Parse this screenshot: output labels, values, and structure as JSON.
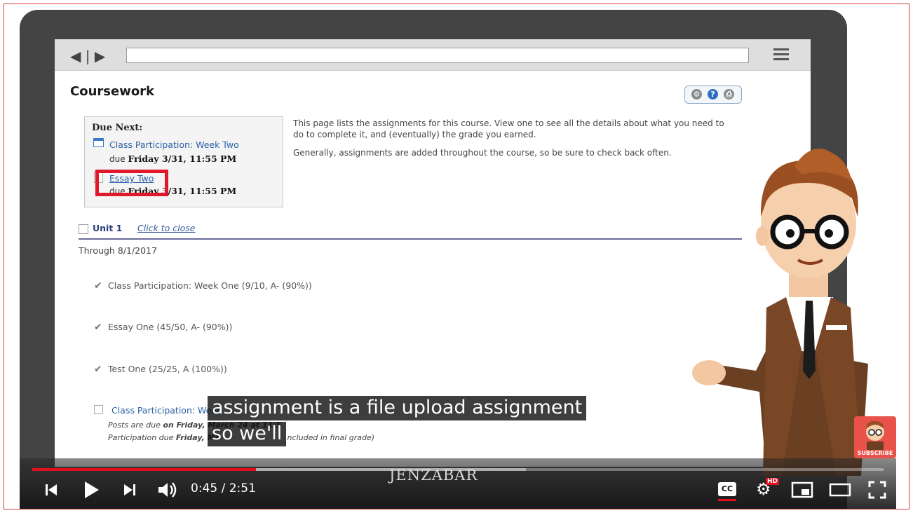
{
  "page": {
    "title": "Coursework",
    "due_next": {
      "heading": "Due Next:",
      "items": [
        {
          "label": "Class Participation: Week Two",
          "due_prefix": "due",
          "due_date": "Friday 3/31, 11:55 PM"
        },
        {
          "label": "Essay Two",
          "due_prefix": "due",
          "due_date": "Friday 3/31, 11:55 PM"
        }
      ]
    },
    "intro": [
      "This page lists the assignments for this course. View one to see all the details about what you need to do to complete it, and (eventually) the grade you earned.",
      "Generally, assignments are added throughout the course, so be sure to check back often."
    ],
    "unit": {
      "label": "Unit 1",
      "close_label": "Click to close",
      "through": "Through 8/1/2017"
    },
    "assignments": [
      {
        "name": "Class Participation: Week One",
        "grade": "(9/10, A- (90%))"
      },
      {
        "name": "Essay One",
        "grade": "(45/50, A- (90%))"
      },
      {
        "name": "Test One",
        "grade": "(25/25, A (100%))"
      },
      {
        "name": "Class Participation: Week",
        "grade": ""
      }
    ],
    "notes": {
      "posts_prefix": "Posts are due",
      "posts_date": "on Friday, March 24 at 11:5",
      "participation_prefix": "Participation due",
      "participation_date": "Friday, Ma",
      "participation_suffix": "ncluded in final grade)"
    }
  },
  "captions": {
    "line1": "assignment is a file upload assignment",
    "line2": "so we'll"
  },
  "player": {
    "current_time": "0:45",
    "duration": "2:51",
    "time_display": "0:45 / 2:51",
    "progress_fraction": 0.263,
    "buffer_fraction": 0.58,
    "brand": "JENZABAR",
    "hd_badge": "HD",
    "cc_label": "CC",
    "subscribe_label": "SUBSCRIBE"
  },
  "icons": {
    "play": "play-icon",
    "previous": "skip-previous-icon",
    "next": "skip-next-icon",
    "volume": "volume-icon",
    "captions": "closed-captions-icon",
    "settings": "gear-icon",
    "miniplayer": "miniplayer-icon",
    "theater": "theater-mode-icon",
    "fullscreen": "fullscreen-icon"
  },
  "colors": {
    "progress": "#e10f1f",
    "highlight_box": "#e0182b",
    "link": "#2a62a8",
    "laptop_bezel": "#444444"
  }
}
